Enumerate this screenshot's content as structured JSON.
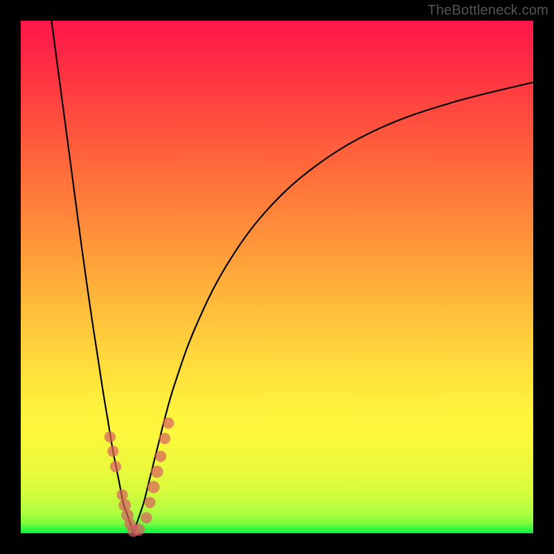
{
  "watermark": "TheBottleneck.com",
  "colors": {
    "frame_border": "#000000",
    "curve_stroke": "#000000",
    "marker_fill": "#d86060",
    "gradient_top": "#ff184a",
    "gradient_bottom": "#00f63f"
  },
  "chart_data": {
    "type": "line",
    "title": "",
    "xlabel": "",
    "ylabel": "",
    "xlim": [
      0,
      100
    ],
    "ylim": [
      0,
      100
    ],
    "grid": false,
    "legend": false,
    "series": [
      {
        "name": "left-curve",
        "x": [
          6,
          8,
          10,
          12,
          14,
          16,
          17,
          18,
          19,
          20,
          21,
          22
        ],
        "y": [
          100,
          85,
          70,
          55,
          41,
          28,
          22,
          16,
          11,
          6,
          3,
          0
        ]
      },
      {
        "name": "right-curve",
        "x": [
          22,
          23,
          24,
          25,
          26,
          27,
          28,
          30,
          34,
          40,
          48,
          58,
          70,
          84,
          100
        ],
        "y": [
          0,
          3,
          6,
          10,
          14,
          18,
          22,
          29,
          40,
          52,
          63,
          72,
          79,
          84,
          88
        ]
      }
    ],
    "markers": [
      {
        "series": "left",
        "x": 17.4,
        "y": 18.8,
        "r": 1.1
      },
      {
        "series": "left",
        "x": 18.0,
        "y": 16.0,
        "r": 1.1
      },
      {
        "series": "left",
        "x": 18.5,
        "y": 13.0,
        "r": 1.1
      },
      {
        "series": "left",
        "x": 19.8,
        "y": 7.5,
        "r": 1.1
      },
      {
        "series": "left",
        "x": 20.3,
        "y": 5.5,
        "r": 1.2
      },
      {
        "series": "left",
        "x": 20.8,
        "y": 3.5,
        "r": 1.2
      },
      {
        "series": "left",
        "x": 21.3,
        "y": 1.8,
        "r": 1.1
      },
      {
        "series": "center",
        "x": 22.0,
        "y": 0.5,
        "r": 1.2
      },
      {
        "series": "center",
        "x": 23.0,
        "y": 0.7,
        "r": 1.2
      },
      {
        "series": "right",
        "x": 24.5,
        "y": 3.0,
        "r": 1.1
      },
      {
        "series": "right",
        "x": 25.2,
        "y": 6.0,
        "r": 1.1
      },
      {
        "series": "right",
        "x": 25.9,
        "y": 9.0,
        "r": 1.2
      },
      {
        "series": "right",
        "x": 26.6,
        "y": 12.0,
        "r": 1.2
      },
      {
        "series": "right",
        "x": 27.3,
        "y": 15.0,
        "r": 1.1
      },
      {
        "series": "right",
        "x": 28.1,
        "y": 18.5,
        "r": 1.1
      },
      {
        "series": "right",
        "x": 28.8,
        "y": 21.5,
        "r": 1.1
      }
    ],
    "notes": "V-shaped bottleneck curve over a vertical green-to-red gradient. Pink markers cluster near the minimum (around x≈17–29, y≈0–22)."
  }
}
